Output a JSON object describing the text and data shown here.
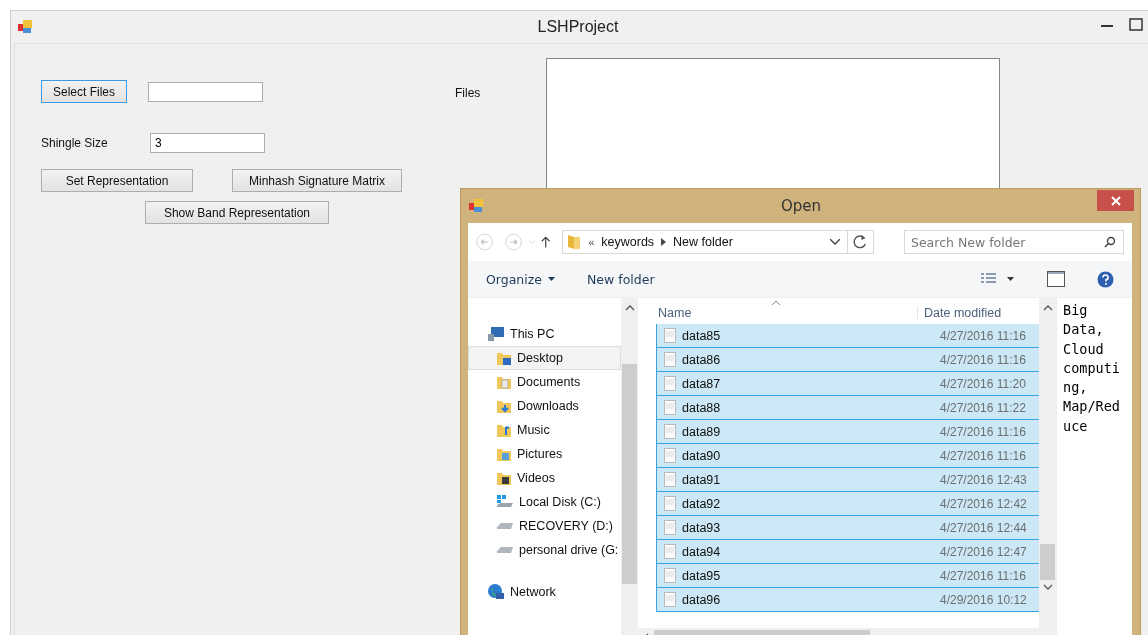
{
  "window": {
    "title": "LSHProject"
  },
  "form": {
    "buttons_top": [
      {
        "label": "Select Files",
        "focused": true
      }
    ],
    "shingle_size": {
      "label": "Shingle Size",
      "value": "3"
    },
    "buttons": [
      {
        "label": "Set Representation",
        "focused": false
      },
      {
        "label": "Minhash Signature Matrix",
        "focused": false
      },
      {
        "label": "Show Band Representation",
        "focused": false
      }
    ],
    "files_label": "Files"
  },
  "dialog": {
    "title": "Open",
    "overflow": "«",
    "breadcrumb": [
      "keywords",
      "New folder"
    ],
    "search": {
      "placeholder": "Search New folder"
    },
    "toolbar": {
      "organize": "Organize",
      "new_folder": "New folder"
    },
    "nav": [
      {
        "label": "This PC",
        "kind": "computer",
        "selected": false,
        "children": [
          {
            "label": "Desktop",
            "kind": "desktop",
            "selected": true
          },
          {
            "label": "Documents",
            "kind": "documents",
            "selected": false
          },
          {
            "label": "Downloads",
            "kind": "downloads",
            "selected": false
          },
          {
            "label": "Music",
            "kind": "music",
            "selected": false
          },
          {
            "label": "Pictures",
            "kind": "pictures",
            "selected": false
          },
          {
            "label": "Videos",
            "kind": "videos",
            "selected": false
          },
          {
            "label": "Local Disk (C:)",
            "kind": "system-drive",
            "selected": false
          },
          {
            "label": "RECOVERY (D:)",
            "kind": "drive",
            "selected": false
          },
          {
            "label": "personal drive (G:",
            "kind": "drive",
            "selected": false
          }
        ]
      },
      {
        "label": "Network",
        "kind": "network",
        "selected": false
      }
    ],
    "columns": [
      "Name",
      "Date modified"
    ],
    "files": [
      {
        "name": "data85",
        "date": "4/27/2016 11:16",
        "selected": true
      },
      {
        "name": "data86",
        "date": "4/27/2016 11:16",
        "selected": true
      },
      {
        "name": "data87",
        "date": "4/27/2016 11:20",
        "selected": true
      },
      {
        "name": "data88",
        "date": "4/27/2016 11:22",
        "selected": true
      },
      {
        "name": "data89",
        "date": "4/27/2016 11:16",
        "selected": true
      },
      {
        "name": "data90",
        "date": "4/27/2016 11:16",
        "selected": true
      },
      {
        "name": "data91",
        "date": "4/27/2016 12:43",
        "selected": true
      },
      {
        "name": "data92",
        "date": "4/27/2016 12:42",
        "selected": true
      },
      {
        "name": "data93",
        "date": "4/27/2016 12:44",
        "selected": true
      },
      {
        "name": "data94",
        "date": "4/27/2016 12:47",
        "selected": true
      },
      {
        "name": "data95",
        "date": "4/27/2016 11:16",
        "selected": true
      },
      {
        "name": "data96",
        "date": "4/29/2016 10:12",
        "selected": true
      }
    ],
    "preview_text": "Big Data, Cloud computing, Map/Reduce"
  }
}
